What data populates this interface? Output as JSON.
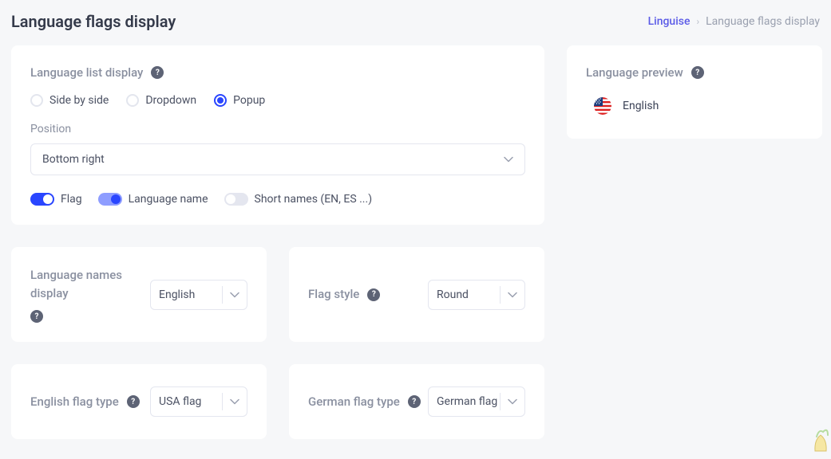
{
  "header": {
    "title": "Language flags display"
  },
  "breadcrumb": {
    "home": "Linguise",
    "current": "Language flags display"
  },
  "listDisplay": {
    "heading": "Language list display",
    "options": {
      "sideBySide": "Side by side",
      "dropdown": "Dropdown",
      "popup": "Popup"
    },
    "selected": "popup",
    "positionLabel": "Position",
    "positionValue": "Bottom right",
    "toggles": {
      "flag": "Flag",
      "languageName": "Language name",
      "shortNames": "Short names (EN, ES ...)"
    }
  },
  "namesDisplay": {
    "label": "Language names display",
    "value": "English"
  },
  "flagStyle": {
    "label": "Flag style",
    "value": "Round"
  },
  "englishFlag": {
    "label": "English flag type",
    "value": "USA flag"
  },
  "germanFlag": {
    "label": "German flag type",
    "value": "German flag"
  },
  "preview": {
    "heading": "Language preview",
    "language": "English"
  }
}
